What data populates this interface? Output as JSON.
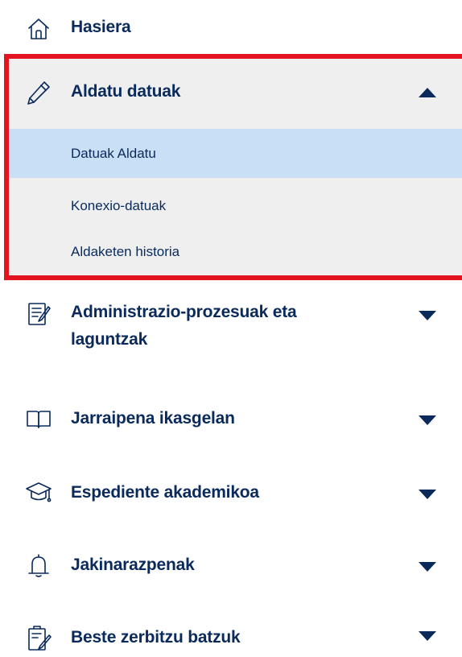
{
  "home": {
    "label": "Hasiera",
    "icon": "home-icon"
  },
  "edit_section": {
    "label": "Aldatu datuak",
    "icon": "pencil-icon",
    "expanded": true,
    "sub_items": [
      {
        "label": "Datuak Aldatu",
        "active": true
      },
      {
        "label": "Konexio-datuak",
        "active": false
      },
      {
        "label": "Aldaketen historia",
        "active": false
      }
    ]
  },
  "sections": [
    {
      "label_line1": "Administrazio-prozesuak eta",
      "label_line2": "laguntzak",
      "icon": "forms-icon"
    },
    {
      "label": "Jarraipena ikasgelan",
      "icon": "open-book-icon"
    },
    {
      "label": "Espediente akademikoa",
      "icon": "graduation-cap-icon"
    },
    {
      "label": "Jakinarazpenak",
      "icon": "bell-icon"
    },
    {
      "label": "Beste zerbitzu batzuk",
      "icon": "clipboard-edit-icon"
    }
  ],
  "colors": {
    "text": "#0a2a5c",
    "highlight_border": "#e3141f",
    "expanded_bg": "#efefef",
    "active_bg": "#c9dff5"
  }
}
